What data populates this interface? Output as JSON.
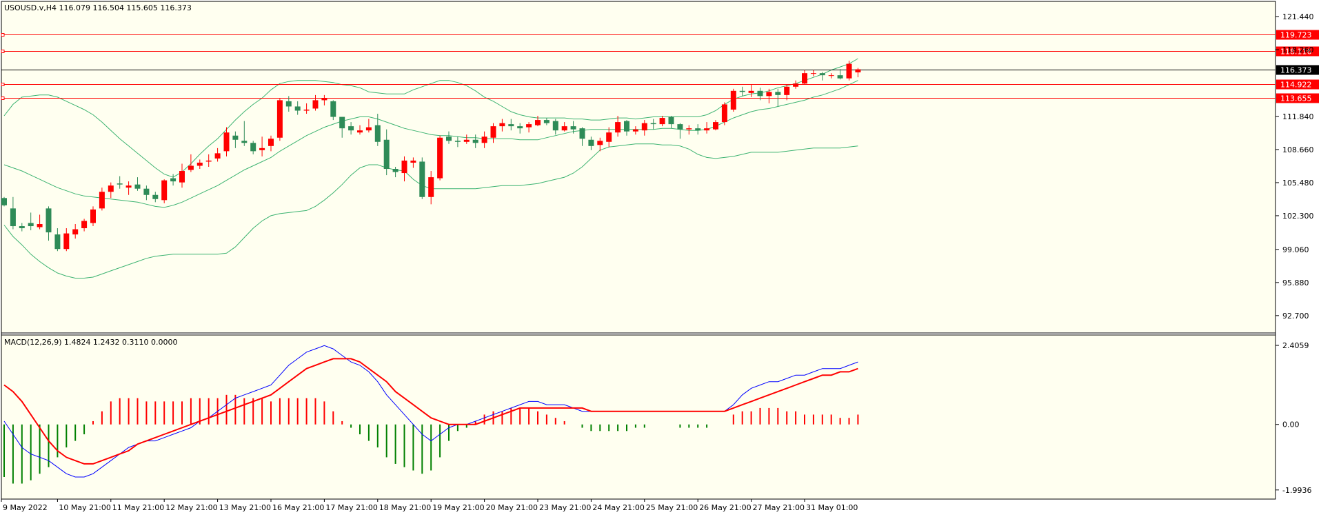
{
  "header": {
    "symbol_line": "USOUSD.v,H4  116.079 116.504 115.605 116.373",
    "macd_line": "MACD(12,26,9) 1.4824 1.2432 0.3110 0.0000"
  },
  "colors": {
    "background": "#fffff0",
    "bull": "#2e8b57",
    "bear": "#ff0000",
    "bands": "#3cb371",
    "macd_main": "#0000ff",
    "macd_signal": "#ff0000",
    "level_line": "#ff0000",
    "price_line": "#000000"
  },
  "chart_data": [
    {
      "type": "candlestick",
      "title": "USOUSD.v,H4",
      "ylim": [
        91.1,
        122.9
      ],
      "price_ticks": [
        "121.440",
        "118.260",
        "111.840",
        "108.660",
        "105.480",
        "102.300",
        "99.060",
        "95.880",
        "92.700"
      ],
      "time_labels": [
        "9 May 2022",
        "10 May 21:00",
        "11 May 21:00",
        "12 May 21:00",
        "13 May 21:00",
        "16 May 21:00",
        "17 May 21:00",
        "18 May 21:00",
        "19 May 21:00",
        "20 May 21:00",
        "23 May 21:00",
        "24 May 21:00",
        "25 May 21:00",
        "26 May 21:00",
        "27 May 21:00",
        "31 May 01:00"
      ],
      "horizontal_levels": [
        {
          "value": 119.723,
          "label": "119.723"
        },
        {
          "value": 118.116,
          "label": "118.116"
        },
        {
          "value": 114.922,
          "label": "114.922"
        },
        {
          "value": 113.655,
          "label": "113.655"
        }
      ],
      "current_price": {
        "value": 116.373,
        "label": "116.373"
      },
      "candles": [
        [
          104.0,
          103.3,
          104.1,
          103.2
        ],
        [
          103.0,
          101.3,
          104.1,
          101.0
        ],
        [
          101.3,
          101.1,
          101.6,
          100.8
        ],
        [
          101.6,
          101.3,
          102.6,
          100.9
        ],
        [
          101.2,
          101.5,
          102.4,
          101.0
        ],
        [
          103.0,
          100.7,
          103.2,
          99.9
        ],
        [
          100.5,
          99.1,
          101.1,
          98.9
        ],
        [
          99.1,
          100.6,
          101.1,
          98.9
        ],
        [
          100.5,
          101.0,
          101.5,
          100.1
        ],
        [
          101.1,
          101.8,
          102.0,
          100.8
        ],
        [
          101.6,
          102.9,
          103.2,
          101.3
        ],
        [
          103.0,
          104.6,
          105.0,
          102.8
        ],
        [
          104.6,
          105.2,
          105.5,
          104.0
        ],
        [
          105.4,
          105.3,
          106.1,
          104.9
        ],
        [
          105.0,
          105.2,
          105.6,
          104.3
        ],
        [
          105.3,
          104.9,
          106.0,
          104.7
        ],
        [
          104.9,
          104.3,
          105.2,
          103.8
        ],
        [
          104.3,
          103.9,
          104.6,
          103.6
        ],
        [
          103.8,
          105.7,
          105.8,
          103.5
        ],
        [
          105.9,
          105.6,
          106.3,
          105.2
        ],
        [
          105.5,
          106.6,
          107.3,
          105.0
        ],
        [
          106.7,
          107.1,
          108.2,
          106.5
        ],
        [
          107.1,
          107.4,
          107.7,
          106.8
        ],
        [
          107.5,
          107.6,
          108.2,
          107.0
        ],
        [
          107.8,
          108.3,
          108.8,
          107.5
        ],
        [
          108.5,
          110.3,
          110.8,
          108.0
        ],
        [
          110.0,
          109.6,
          110.4,
          108.8
        ],
        [
          109.5,
          109.3,
          111.4,
          109.0
        ],
        [
          109.3,
          108.5,
          109.5,
          108.2
        ],
        [
          108.6,
          108.8,
          109.9,
          108.0
        ],
        [
          109.0,
          109.7,
          110.0,
          108.5
        ],
        [
          109.8,
          113.4,
          113.6,
          109.5
        ],
        [
          113.3,
          112.8,
          113.8,
          112.3
        ],
        [
          112.8,
          112.4,
          113.3,
          112.0
        ],
        [
          112.4,
          112.5,
          113.1,
          112.1
        ],
        [
          112.6,
          113.4,
          113.9,
          112.4
        ],
        [
          113.4,
          113.6,
          113.9,
          112.9
        ],
        [
          113.3,
          111.8,
          113.4,
          111.5
        ],
        [
          111.8,
          110.7,
          111.8,
          109.8
        ],
        [
          110.9,
          110.5,
          111.3,
          110.1
        ],
        [
          110.3,
          110.5,
          111.0,
          110.1
        ],
        [
          110.5,
          110.8,
          111.6,
          110.3
        ],
        [
          111.0,
          109.4,
          112.1,
          109.0
        ],
        [
          109.6,
          106.8,
          110.6,
          106.2
        ],
        [
          106.8,
          106.5,
          107.0,
          106.0
        ],
        [
          106.4,
          107.6,
          108.0,
          105.6
        ],
        [
          107.4,
          107.6,
          107.9,
          106.9
        ],
        [
          107.5,
          104.1,
          107.9,
          103.9
        ],
        [
          104.1,
          106.0,
          106.6,
          103.4
        ],
        [
          105.9,
          109.8,
          110.0,
          105.7
        ],
        [
          109.9,
          109.5,
          110.4,
          109.2
        ],
        [
          109.5,
          109.4,
          109.9,
          108.9
        ],
        [
          109.4,
          109.6,
          110.1,
          109.2
        ],
        [
          109.6,
          109.3,
          110.1,
          108.8
        ],
        [
          109.3,
          109.9,
          110.4,
          108.8
        ],
        [
          109.8,
          110.9,
          111.2,
          109.3
        ],
        [
          110.9,
          111.2,
          111.6,
          110.4
        ],
        [
          111.1,
          110.9,
          111.6,
          110.5
        ],
        [
          110.9,
          110.7,
          111.2,
          110.2
        ],
        [
          110.8,
          111.1,
          111.3,
          110.3
        ],
        [
          111.0,
          111.5,
          111.9,
          110.9
        ],
        [
          111.5,
          111.2,
          111.7,
          111.0
        ],
        [
          111.4,
          110.5,
          111.6,
          110.1
        ],
        [
          110.5,
          110.9,
          111.3,
          110.4
        ],
        [
          110.9,
          110.6,
          111.4,
          110.2
        ],
        [
          110.7,
          109.7,
          110.8,
          109.0
        ],
        [
          109.6,
          109.0,
          109.9,
          108.6
        ],
        [
          109.1,
          109.5,
          109.8,
          108.5
        ],
        [
          109.4,
          110.3,
          110.8,
          108.9
        ],
        [
          110.3,
          111.3,
          111.9,
          109.9
        ],
        [
          111.4,
          110.4,
          111.5,
          110.0
        ],
        [
          110.4,
          110.6,
          110.9,
          110.1
        ],
        [
          110.5,
          111.2,
          111.5,
          110.0
        ],
        [
          111.2,
          111.1,
          111.6,
          110.6
        ],
        [
          111.1,
          111.7,
          111.9,
          110.9
        ],
        [
          111.8,
          111.1,
          111.9,
          110.7
        ],
        [
          111.1,
          110.6,
          111.2,
          109.7
        ],
        [
          110.6,
          110.7,
          111.0,
          110.1
        ],
        [
          110.7,
          110.5,
          111.1,
          110.1
        ],
        [
          110.5,
          110.7,
          111.3,
          110.2
        ],
        [
          110.6,
          111.3,
          111.5,
          110.5
        ],
        [
          111.3,
          113.0,
          113.2,
          111.0
        ],
        [
          112.5,
          114.3,
          114.5,
          112.3
        ],
        [
          114.3,
          114.2,
          114.7,
          113.8
        ],
        [
          114.1,
          114.3,
          114.9,
          113.7
        ],
        [
          114.3,
          113.8,
          114.6,
          113.4
        ],
        [
          113.8,
          114.2,
          114.5,
          113.1
        ],
        [
          114.2,
          113.9,
          114.5,
          112.8
        ],
        [
          113.9,
          114.7,
          114.9,
          113.4
        ],
        [
          114.7,
          115.0,
          115.3,
          114.5
        ],
        [
          115.0,
          116.0,
          116.3,
          114.9
        ],
        [
          116.0,
          116.0,
          116.3,
          115.7
        ],
        [
          116.0,
          115.8,
          116.1,
          115.3
        ],
        [
          115.8,
          115.8,
          116.0,
          115.5
        ],
        [
          115.8,
          115.5,
          116.4,
          115.4
        ],
        [
          115.5,
          116.9,
          117.2,
          115.3
        ],
        [
          116.079,
          116.373,
          116.504,
          115.605
        ]
      ],
      "bollinger": {
        "upper": [
          111.9,
          113.0,
          113.7,
          113.8,
          113.9,
          113.9,
          113.7,
          113.3,
          112.9,
          112.5,
          112.0,
          111.3,
          110.5,
          109.7,
          109.0,
          108.3,
          107.6,
          106.9,
          106.3,
          106.0,
          106.5,
          107.3,
          108.2,
          109.0,
          109.7,
          110.6,
          111.5,
          112.3,
          113.0,
          113.6,
          114.4,
          115.0,
          115.2,
          115.3,
          115.3,
          115.3,
          115.2,
          115.1,
          114.9,
          114.8,
          114.6,
          114.2,
          114.1,
          114.0,
          114.0,
          114.0,
          114.4,
          114.7,
          115.0,
          115.3,
          115.3,
          115.1,
          114.8,
          114.3,
          113.7,
          113.3,
          112.8,
          112.3,
          112.0,
          111.8,
          111.7,
          111.7,
          111.7,
          111.7,
          111.6,
          111.6,
          111.5,
          111.5,
          111.6,
          111.7,
          111.7,
          111.6,
          111.7,
          111.8,
          111.8,
          111.8,
          111.8,
          111.8,
          111.8,
          112.0,
          112.4,
          113.0,
          113.5,
          113.8,
          114.0,
          114.1,
          114.3,
          114.6,
          114.8,
          115.0,
          115.3,
          115.6,
          115.9,
          116.3,
          116.6,
          116.9,
          117.4
        ],
        "middle": [
          107.2,
          106.9,
          106.6,
          106.2,
          105.8,
          105.4,
          105.0,
          104.7,
          104.4,
          104.2,
          104.1,
          104.0,
          103.9,
          103.8,
          103.7,
          103.6,
          103.4,
          103.2,
          103.1,
          103.3,
          103.6,
          104.0,
          104.4,
          104.8,
          105.2,
          105.7,
          106.2,
          106.7,
          107.1,
          107.5,
          107.9,
          108.5,
          109.0,
          109.5,
          110.0,
          110.4,
          110.8,
          111.1,
          111.4,
          111.6,
          111.8,
          111.8,
          111.6,
          111.3,
          111.0,
          110.7,
          110.5,
          110.3,
          110.1,
          110.0,
          110.0,
          109.9,
          109.8,
          109.8,
          109.7,
          109.7,
          109.7,
          109.7,
          109.6,
          109.6,
          109.6,
          109.8,
          110.0,
          110.2,
          110.4,
          110.5,
          110.6,
          110.6,
          110.6,
          110.6,
          110.6,
          110.6,
          110.6,
          110.6,
          110.7,
          110.7,
          110.6,
          110.5,
          110.5,
          110.6,
          110.9,
          111.3,
          111.7,
          112.0,
          112.3,
          112.5,
          112.6,
          112.8,
          113.0,
          113.2,
          113.4,
          113.7,
          113.9,
          114.2,
          114.5,
          114.9,
          115.3
        ],
        "lower": [
          101.4,
          100.3,
          99.5,
          98.6,
          97.9,
          97.3,
          96.8,
          96.5,
          96.3,
          96.3,
          96.4,
          96.7,
          97.0,
          97.3,
          97.6,
          97.9,
          98.2,
          98.4,
          98.5,
          98.6,
          98.6,
          98.6,
          98.6,
          98.6,
          98.6,
          98.7,
          99.3,
          100.2,
          101.1,
          101.8,
          102.3,
          102.5,
          102.6,
          102.7,
          102.8,
          103.2,
          103.8,
          104.5,
          105.3,
          106.2,
          106.9,
          107.2,
          107.2,
          106.9,
          106.7,
          106.6,
          105.8,
          105.2,
          104.9,
          104.9,
          104.9,
          104.9,
          104.9,
          104.9,
          105.0,
          105.1,
          105.2,
          105.2,
          105.2,
          105.3,
          105.4,
          105.6,
          105.8,
          106.0,
          106.4,
          107.0,
          107.8,
          108.6,
          108.9,
          109.0,
          109.1,
          109.2,
          109.2,
          109.2,
          109.1,
          109.1,
          109.0,
          108.7,
          108.2,
          107.9,
          107.8,
          107.9,
          108.0,
          108.2,
          108.4,
          108.4,
          108.4,
          108.4,
          108.5,
          108.6,
          108.7,
          108.8,
          108.8,
          108.8,
          108.8,
          108.9,
          109.0
        ]
      }
    },
    {
      "type": "macd",
      "title": "MACD(12,26,9)",
      "ylim": [
        -2.25,
        2.7
      ],
      "ticks": [
        "2.4059",
        "0.00",
        "-1.9936"
      ],
      "main": [
        0.1,
        -0.3,
        -0.7,
        -0.9,
        -1.0,
        -1.1,
        -1.3,
        -1.5,
        -1.6,
        -1.6,
        -1.5,
        -1.3,
        -1.1,
        -0.9,
        -0.7,
        -0.6,
        -0.5,
        -0.5,
        -0.4,
        -0.3,
        -0.2,
        -0.1,
        0.1,
        0.2,
        0.4,
        0.6,
        0.8,
        0.9,
        1.0,
        1.1,
        1.2,
        1.5,
        1.8,
        2.0,
        2.2,
        2.3,
        2.4,
        2.3,
        2.1,
        1.9,
        1.8,
        1.6,
        1.3,
        0.9,
        0.6,
        0.3,
        0.0,
        -0.3,
        -0.5,
        -0.3,
        -0.1,
        0.0,
        0.0,
        0.1,
        0.2,
        0.3,
        0.4,
        0.5,
        0.6,
        0.7,
        0.7,
        0.6,
        0.6,
        0.6,
        0.5,
        0.4,
        0.4,
        0.4,
        0.4,
        0.4,
        0.4,
        0.4,
        0.4,
        0.4,
        0.4,
        0.4,
        0.4,
        0.4,
        0.4,
        0.4,
        0.4,
        0.4,
        0.6,
        0.9,
        1.1,
        1.2,
        1.3,
        1.3,
        1.4,
        1.5,
        1.5,
        1.6,
        1.7,
        1.7,
        1.7,
        1.8,
        1.9
      ],
      "signal": [
        1.2,
        1.0,
        0.7,
        0.3,
        -0.1,
        -0.5,
        -0.8,
        -1.0,
        -1.1,
        -1.2,
        -1.2,
        -1.1,
        -1.0,
        -0.9,
        -0.8,
        -0.6,
        -0.5,
        -0.4,
        -0.3,
        -0.2,
        -0.1,
        0.0,
        0.1,
        0.2,
        0.3,
        0.4,
        0.5,
        0.6,
        0.7,
        0.8,
        0.9,
        1.1,
        1.3,
        1.5,
        1.7,
        1.8,
        1.9,
        2.0,
        2.0,
        2.0,
        1.9,
        1.7,
        1.5,
        1.3,
        1.0,
        0.8,
        0.6,
        0.4,
        0.2,
        0.1,
        0.0,
        0.0,
        0.0,
        0.0,
        0.1,
        0.2,
        0.3,
        0.4,
        0.5,
        0.5,
        0.5,
        0.5,
        0.5,
        0.5,
        0.5,
        0.5,
        0.4,
        0.4,
        0.4,
        0.4,
        0.4,
        0.4,
        0.4,
        0.4,
        0.4,
        0.4,
        0.4,
        0.4,
        0.4,
        0.4,
        0.4,
        0.4,
        0.5,
        0.6,
        0.7,
        0.8,
        0.9,
        1.0,
        1.1,
        1.2,
        1.3,
        1.4,
        1.5,
        1.5,
        1.6,
        1.6,
        1.7
      ],
      "histogram": [
        -1.6,
        -1.8,
        -1.8,
        -1.7,
        -1.5,
        -1.3,
        -1.0,
        -0.7,
        -0.5,
        -0.3,
        0.1,
        0.4,
        0.7,
        0.8,
        0.8,
        0.8,
        0.7,
        0.7,
        0.7,
        0.7,
        0.7,
        0.8,
        0.8,
        0.8,
        0.8,
        0.9,
        0.9,
        0.8,
        0.8,
        0.8,
        0.7,
        0.8,
        0.8,
        0.8,
        0.8,
        0.8,
        0.7,
        0.4,
        0.1,
        -0.1,
        -0.3,
        -0.5,
        -0.7,
        -1.0,
        -1.2,
        -1.3,
        -1.4,
        -1.5,
        -1.4,
        -1.0,
        -0.5,
        -0.2,
        -0.1,
        0.1,
        0.3,
        0.4,
        0.4,
        0.5,
        0.5,
        0.5,
        0.4,
        0.3,
        0.2,
        0.1,
        0.0,
        -0.1,
        -0.2,
        -0.2,
        -0.2,
        -0.2,
        -0.2,
        -0.1,
        -0.1,
        0.0,
        0.0,
        0.0,
        -0.1,
        -0.1,
        -0.1,
        -0.1,
        0.0,
        0.0,
        0.3,
        0.4,
        0.4,
        0.5,
        0.5,
        0.5,
        0.4,
        0.4,
        0.3,
        0.3,
        0.3,
        0.3,
        0.2,
        0.2,
        0.3
      ]
    }
  ]
}
